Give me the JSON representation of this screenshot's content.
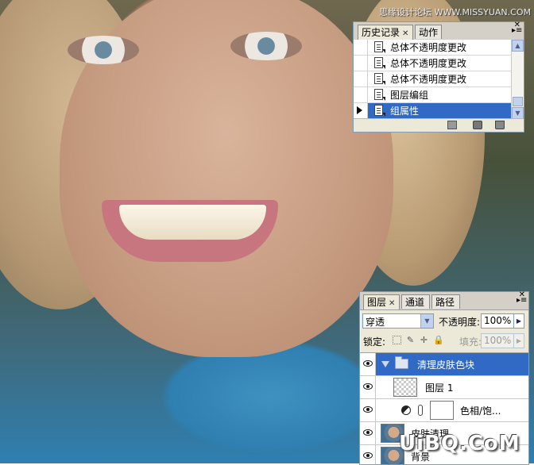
{
  "watermark": {
    "top": "思缘设计论坛 WWW.MISSYUAN.COM",
    "bottom": "UiBQ.CoM"
  },
  "history_panel": {
    "tabs": [
      {
        "label": "历史记录",
        "active": true
      },
      {
        "label": "动作",
        "active": false
      }
    ],
    "items": [
      {
        "label": "总体不透明度更改",
        "selected": false
      },
      {
        "label": "总体不透明度更改",
        "selected": false
      },
      {
        "label": "总体不透明度更改",
        "selected": false
      },
      {
        "label": "图层编组",
        "selected": false
      },
      {
        "label": "组属性",
        "selected": true
      }
    ],
    "footer_icons": [
      "new-document-icon",
      "camera-snapshot-icon",
      "trash-icon"
    ]
  },
  "layers_panel": {
    "tabs": [
      {
        "label": "图层",
        "active": true
      },
      {
        "label": "通道",
        "active": false
      },
      {
        "label": "路径",
        "active": false
      }
    ],
    "blend_mode": "穿透",
    "opacity_label": "不透明度:",
    "opacity_value": "100%",
    "lock_label": "锁定:",
    "fill_label": "填充:",
    "fill_value": "100%",
    "layers": [
      {
        "name": "清理皮肤色块",
        "kind": "group",
        "selected": true
      },
      {
        "name": "图层 1",
        "kind": "pixel",
        "selected": false
      },
      {
        "name": "色相/饱...",
        "kind": "adjustment",
        "selected": false
      },
      {
        "name": "皮肤清理",
        "kind": "photo",
        "selected": false
      },
      {
        "name": "背景",
        "kind": "photo",
        "selected": false
      }
    ]
  },
  "colors": {
    "selection": "#316ac5",
    "panel_bg": "#ece9d8"
  }
}
